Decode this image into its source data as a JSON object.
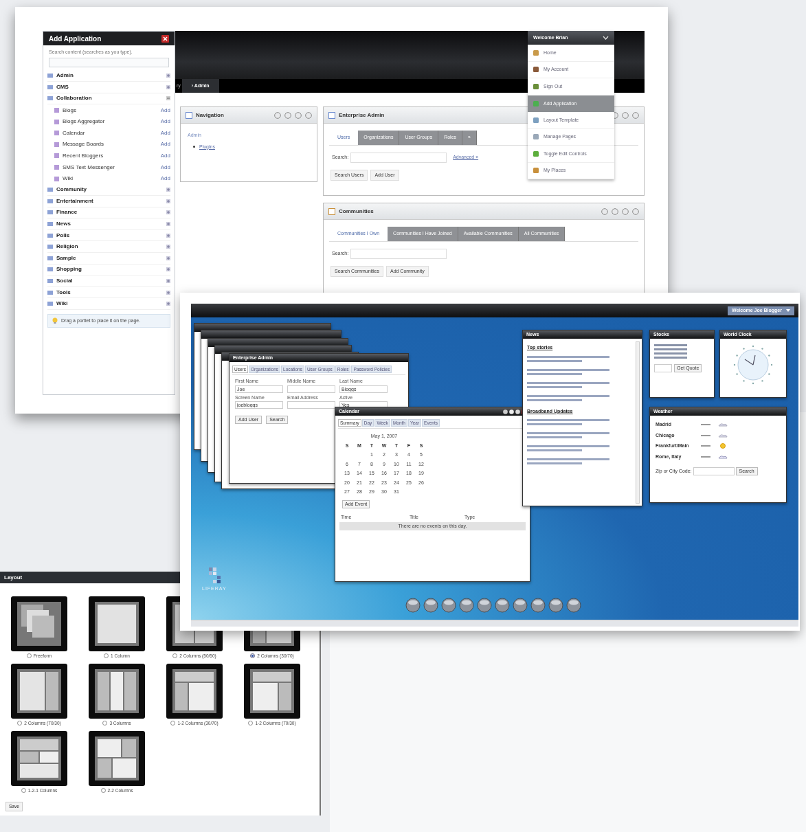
{
  "admin_screenshot": {
    "add_application": {
      "title": "Add Application",
      "search_label": "Search content (searches as you type).",
      "categories": [
        {
          "label": "Admin",
          "expanded": false
        },
        {
          "label": "CMS",
          "expanded": false
        },
        {
          "label": "Collaboration",
          "expanded": true,
          "children": [
            {
              "label": "Blogs",
              "action": "Add"
            },
            {
              "label": "Blogs Aggregator",
              "action": "Add"
            },
            {
              "label": "Calendar",
              "action": "Add"
            },
            {
              "label": "Message Boards",
              "action": "Add"
            },
            {
              "label": "Recent Bloggers",
              "action": "Add"
            },
            {
              "label": "SMS Text Messenger",
              "action": "Add"
            },
            {
              "label": "Wiki",
              "action": "Add"
            }
          ]
        },
        {
          "label": "Community",
          "expanded": false
        },
        {
          "label": "Entertainment",
          "expanded": false
        },
        {
          "label": "Finance",
          "expanded": false
        },
        {
          "label": "News",
          "expanded": false
        },
        {
          "label": "Polls",
          "expanded": false
        },
        {
          "label": "Religion",
          "expanded": false
        },
        {
          "label": "Sample",
          "expanded": false
        },
        {
          "label": "Shopping",
          "expanded": false
        },
        {
          "label": "Social",
          "expanded": false
        },
        {
          "label": "Tools",
          "expanded": false
        },
        {
          "label": "Wiki",
          "expanded": false
        }
      ],
      "tip": "Drag a portlet to place it on the page."
    },
    "nav_tabs": [
      {
        "label": "ry",
        "selected": false
      },
      {
        "label": "› Admin",
        "selected": true
      }
    ],
    "user_menu": {
      "title": "Welcome Brian",
      "items": [
        {
          "label": "Home",
          "selected": false
        },
        {
          "label": "My Account",
          "selected": false
        },
        {
          "label": "Sign Out",
          "selected": false
        },
        {
          "label": "Add Application",
          "selected": true
        },
        {
          "label": "Layout Template",
          "selected": false
        },
        {
          "label": "Manage Pages",
          "selected": false
        },
        {
          "label": "Toggle Edit Controls",
          "selected": false
        },
        {
          "label": "My Places",
          "selected": false
        }
      ]
    },
    "navigation": {
      "title": "Navigation",
      "links": [
        {
          "label": "Admin",
          "children": [
            {
              "label": "Plugins"
            }
          ]
        }
      ]
    },
    "enterprise_admin": {
      "title": "Enterprise Admin",
      "tabs": [
        {
          "label": "Users",
          "selected": true
        },
        {
          "label": "Organizations",
          "selected": false
        },
        {
          "label": "User Groups",
          "selected": false
        },
        {
          "label": "Roles",
          "selected": false
        },
        {
          "label": "»",
          "selected": false
        }
      ],
      "search_label": "Search:",
      "advanced_link": "Advanced »",
      "buttons": [
        "Search Users",
        "Add User"
      ]
    },
    "communities": {
      "title": "Communities",
      "tabs": [
        {
          "label": "Communities I Own",
          "selected": true
        },
        {
          "label": "Communities I Have Joined",
          "selected": false
        },
        {
          "label": "Available Communities",
          "selected": false
        },
        {
          "label": "All Communities",
          "selected": false
        }
      ],
      "search_label": "Search:",
      "buttons": [
        "Search Communities",
        "Add Community"
      ]
    }
  },
  "layout_panel": {
    "title": "Layout",
    "options": [
      {
        "label": "Freeform",
        "selected": false
      },
      {
        "label": "1 Column",
        "selected": false
      },
      {
        "label": "2 Columns (50/50)",
        "selected": false
      },
      {
        "label": "2 Columns (30/70)",
        "selected": true
      },
      {
        "label": "2 Columns (70/30)",
        "selected": false
      },
      {
        "label": "3 Columns",
        "selected": false
      },
      {
        "label": "1-2 Columns (30/70)",
        "selected": false
      },
      {
        "label": "1-2 Columns (70/30)",
        "selected": false
      },
      {
        "label": "1-2-1 Columns",
        "selected": false
      },
      {
        "label": "2-2 Columns",
        "selected": false
      }
    ],
    "save": "Save"
  },
  "desktop_screenshot": {
    "welcome": "Welcome Joe Blogger",
    "logo": "LIFERAY",
    "enterprise_admin": {
      "title": "Enterprise Admin",
      "tabs": [
        {
          "label": "Users",
          "selected": true
        },
        {
          "label": "Organizations",
          "selected": false
        },
        {
          "label": "Locations",
          "selected": false
        },
        {
          "label": "User Groups",
          "selected": false
        },
        {
          "label": "Roles",
          "selected": false
        },
        {
          "label": "Password Policies",
          "selected": false
        }
      ],
      "fields": [
        {
          "label": "First Name",
          "value": "Joe"
        },
        {
          "label": "Middle Name"
        },
        {
          "label": "Last Name",
          "value": "Bloggs"
        },
        {
          "label": "Screen Name",
          "value": "joebloggs"
        },
        {
          "label": "Email Address"
        },
        {
          "label": "Active",
          "value": "Yes"
        }
      ],
      "buttons": [
        "Add User",
        "Search"
      ]
    },
    "calendar": {
      "title": "Calendar",
      "tabs": [
        {
          "label": "Summary",
          "selected": true
        },
        {
          "label": "Day",
          "selected": false
        },
        {
          "label": "Week",
          "selected": false
        },
        {
          "label": "Month",
          "selected": false
        },
        {
          "label": "Year",
          "selected": false
        },
        {
          "label": "Events",
          "selected": false
        }
      ],
      "date": "May 1, 2007",
      "weekdays": [
        "S",
        "M",
        "T",
        "W",
        "T",
        "F",
        "S"
      ],
      "weeks": [
        {
          "kind": "leading",
          "days": [
            "1",
            "2",
            "3",
            "4",
            "5"
          ]
        },
        {
          "kind": "full",
          "days": [
            "6",
            "7",
            "8",
            "9",
            "10",
            "11",
            "12"
          ]
        },
        {
          "kind": "full",
          "days": [
            "13",
            "14",
            "15",
            "16",
            "17",
            "18",
            "19"
          ]
        },
        {
          "kind": "full",
          "days": [
            "20",
            "21",
            "22",
            "23",
            "24",
            "25",
            "26"
          ]
        },
        {
          "kind": "trailing",
          "days": [
            "27",
            "28",
            "29",
            "30",
            "31"
          ]
        }
      ],
      "add_event": "Add Event",
      "columns": [
        "Time",
        "Title",
        "Type"
      ],
      "empty_message": "There are no events on this day."
    },
    "news": {
      "title": "News",
      "heading": "Top stories",
      "second_heading": "Broadband Updates"
    },
    "stocks": {
      "title": "Stocks",
      "button": "Get Quote"
    },
    "world_clock": {
      "title": "World Clock"
    },
    "weather": {
      "title": "Weather",
      "cities": [
        {
          "name": "Madrid"
        },
        {
          "name": "Chicago"
        },
        {
          "name": "Frankfurt/Main"
        },
        {
          "name": "Rome, Italy"
        }
      ],
      "zip_label": "Zip or City Code:",
      "button": "Search"
    }
  }
}
